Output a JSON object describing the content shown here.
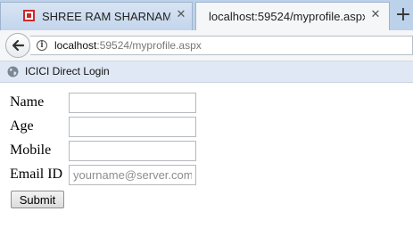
{
  "browser": {
    "tabs": [
      {
        "title": "SHREE RAM SHARNAM - Inte",
        "active": false,
        "close_glyph": "✕"
      },
      {
        "title": "localhost:59524/myprofile.aspx",
        "active": true,
        "close_glyph": "✕"
      }
    ],
    "new_tab_glyph": "+",
    "url_host": "localhost",
    "url_rest": ":59524/myprofile.aspx",
    "bookmarks": [
      {
        "label": "ICICI Direct Login",
        "icon": "globe-icon"
      }
    ]
  },
  "form": {
    "fields": [
      {
        "label": "Name",
        "value": "",
        "placeholder": ""
      },
      {
        "label": "Age",
        "value": "",
        "placeholder": ""
      },
      {
        "label": "Mobile",
        "value": "",
        "placeholder": ""
      },
      {
        "label": "Email ID",
        "value": "",
        "placeholder": "yourname@server.com"
      }
    ],
    "submit_label": "Submit"
  }
}
